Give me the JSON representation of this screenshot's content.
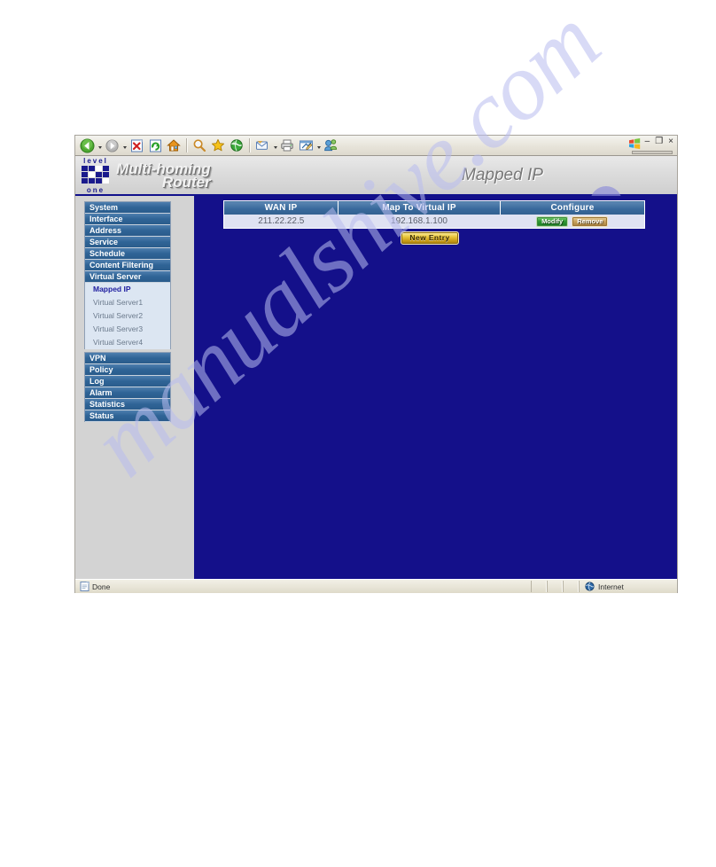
{
  "window": {
    "controls": {
      "minimize": "–",
      "restore": "❐",
      "close": "×"
    },
    "os_logo_icon": "windows-logo-icon"
  },
  "toolbar": {
    "buttons": [
      {
        "name": "back-button",
        "icon": "back-arrow-icon",
        "label": "Back"
      },
      {
        "name": "forward-button",
        "icon": "forward-arrow-icon",
        "label": "Forward"
      },
      {
        "name": "stop-button",
        "icon": "stop-icon",
        "label": "Stop"
      },
      {
        "name": "refresh-button",
        "icon": "refresh-icon",
        "label": "Refresh"
      },
      {
        "name": "home-button",
        "icon": "home-icon",
        "label": "Home"
      },
      {
        "name": "search-button",
        "icon": "search-icon",
        "label": "Search"
      },
      {
        "name": "favorites-button",
        "icon": "star-icon",
        "label": "Favorites"
      },
      {
        "name": "history-button",
        "icon": "history-globe-icon",
        "label": "History"
      },
      {
        "name": "mail-button",
        "icon": "mail-icon",
        "label": "Mail"
      },
      {
        "name": "print-button",
        "icon": "printer-icon",
        "label": "Print"
      },
      {
        "name": "edit-button",
        "icon": "edit-page-icon",
        "label": "Edit"
      },
      {
        "name": "messenger-button",
        "icon": "messenger-icon",
        "label": "Messenger"
      }
    ]
  },
  "banner": {
    "logo": {
      "top_text": "level",
      "bottom_text": "one"
    },
    "product_line1": "Multi-homing",
    "product_line2": "Router",
    "page_title": "Mapped IP"
  },
  "sidebar": {
    "items": [
      {
        "label": "System",
        "type": "main"
      },
      {
        "label": "Interface",
        "type": "main"
      },
      {
        "label": "Address",
        "type": "main"
      },
      {
        "label": "Service",
        "type": "main"
      },
      {
        "label": "Schedule",
        "type": "main"
      },
      {
        "label": "Content Filtering",
        "type": "main"
      },
      {
        "label": "Virtual Server",
        "type": "main"
      }
    ],
    "submenu": [
      {
        "label": "Mapped IP",
        "active": true
      },
      {
        "label": "Virtual Server1",
        "active": false
      },
      {
        "label": "Virtual Server2",
        "active": false
      },
      {
        "label": "Virtual Server3",
        "active": false
      },
      {
        "label": "Virtual Server4",
        "active": false
      }
    ],
    "items_after": [
      {
        "label": "VPN",
        "type": "main"
      },
      {
        "label": "Policy",
        "type": "main"
      },
      {
        "label": "Log",
        "type": "main"
      },
      {
        "label": "Alarm",
        "type": "main"
      },
      {
        "label": "Statistics",
        "type": "main"
      },
      {
        "label": "Status",
        "type": "main"
      }
    ]
  },
  "table": {
    "headers": [
      "WAN IP",
      "Map To Virtual IP",
      "Configure"
    ],
    "rows": [
      {
        "wan_ip": "211.22.22.5",
        "virtual_ip": "192.168.1.100",
        "modify_label": "Modify",
        "remove_label": "Remove"
      }
    ]
  },
  "actions": {
    "new_entry_label": "New Entry"
  },
  "statusbar": {
    "message": "Done",
    "zone": "Internet",
    "zone_icon": "internet-globe-icon"
  },
  "watermark": {
    "text": "manualshive.com"
  },
  "colors": {
    "content_blue": "#14108a",
    "header_blue": "#32608f",
    "menu_blue": "#2f6496",
    "submenu_bg": "#dce6f2",
    "row_bg": "#dfe2f2",
    "modify_green": "#2f9a33",
    "remove_tan": "#caa460",
    "newentry_gold": "#e8c63a"
  }
}
